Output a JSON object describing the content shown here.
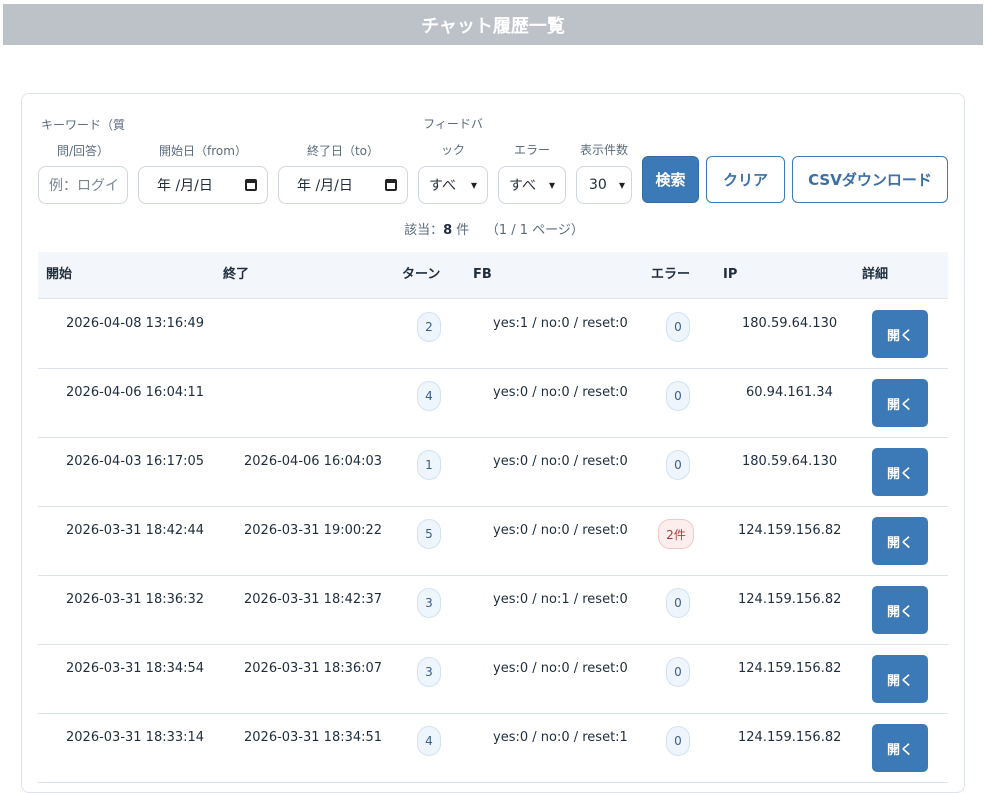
{
  "header": {
    "title": "チャット履歴一覧"
  },
  "filters": {
    "keyword_label_1": "キーワード（質",
    "keyword_label_2": "問/回答）",
    "keyword_placeholder": "例：ログイ",
    "from_label": "開始日（from）",
    "from_value": "年 /月/日",
    "to_label": "終了日（to）",
    "to_value": "年 /月/日",
    "feedback_label_1": "フィードバ",
    "feedback_label_2": "ック",
    "feedback_value": "すべ",
    "error_label": "エラー",
    "error_value": "すべ",
    "count_label": "表示件数",
    "count_value": "30",
    "search_button": "検索",
    "clear_button": "クリア",
    "csv_button": "CSVダウンロード"
  },
  "summary": {
    "prefix": "該当：",
    "count": "8",
    "unit": "件",
    "pages": "（1 / 1 ページ）"
  },
  "table": {
    "headers": {
      "start": "開始",
      "end": "終了",
      "turns": "ターン",
      "fb": "FB",
      "error": "エラー",
      "ip": "IP",
      "detail": "詳細"
    },
    "rows": [
      {
        "start": "2026-04-08 13:16:49",
        "end": "",
        "turns": "2",
        "fb": "yes:1 / no:0 / reset:0",
        "error": "0",
        "ip": "180.59.64.130",
        "action": "開く"
      },
      {
        "start": "2026-04-06 16:04:11",
        "end": "",
        "turns": "4",
        "fb": "yes:0 / no:0 / reset:0",
        "error": "0",
        "ip": "60.94.161.34",
        "action": "開く"
      },
      {
        "start": "2026-04-03 16:17:05",
        "end": "2026-04-06 16:04:03",
        "turns": "1",
        "fb": "yes:0 / no:0 / reset:0",
        "error": "0",
        "ip": "180.59.64.130",
        "action": "開く"
      },
      {
        "start": "2026-03-31 18:42:44",
        "end": "2026-03-31 19:00:22",
        "turns": "5",
        "fb": "yes:0 / no:0 / reset:0",
        "error": "2件",
        "ip": "124.159.156.82",
        "action": "開く"
      },
      {
        "start": "2026-03-31 18:36:32",
        "end": "2026-03-31 18:42:37",
        "turns": "3",
        "fb": "yes:0 / no:1 / reset:0",
        "error": "0",
        "ip": "124.159.156.82",
        "action": "開く"
      },
      {
        "start": "2026-03-31 18:34:54",
        "end": "2026-03-31 18:36:07",
        "turns": "3",
        "fb": "yes:0 / no:0 / reset:0",
        "error": "0",
        "ip": "124.159.156.82",
        "action": "開く"
      },
      {
        "start": "2026-03-31 18:33:14",
        "end": "2026-03-31 18:34:51",
        "turns": "4",
        "fb": "yes:0 / no:0 / reset:1",
        "error": "0",
        "ip": "124.159.156.82",
        "action": "開く"
      }
    ]
  }
}
